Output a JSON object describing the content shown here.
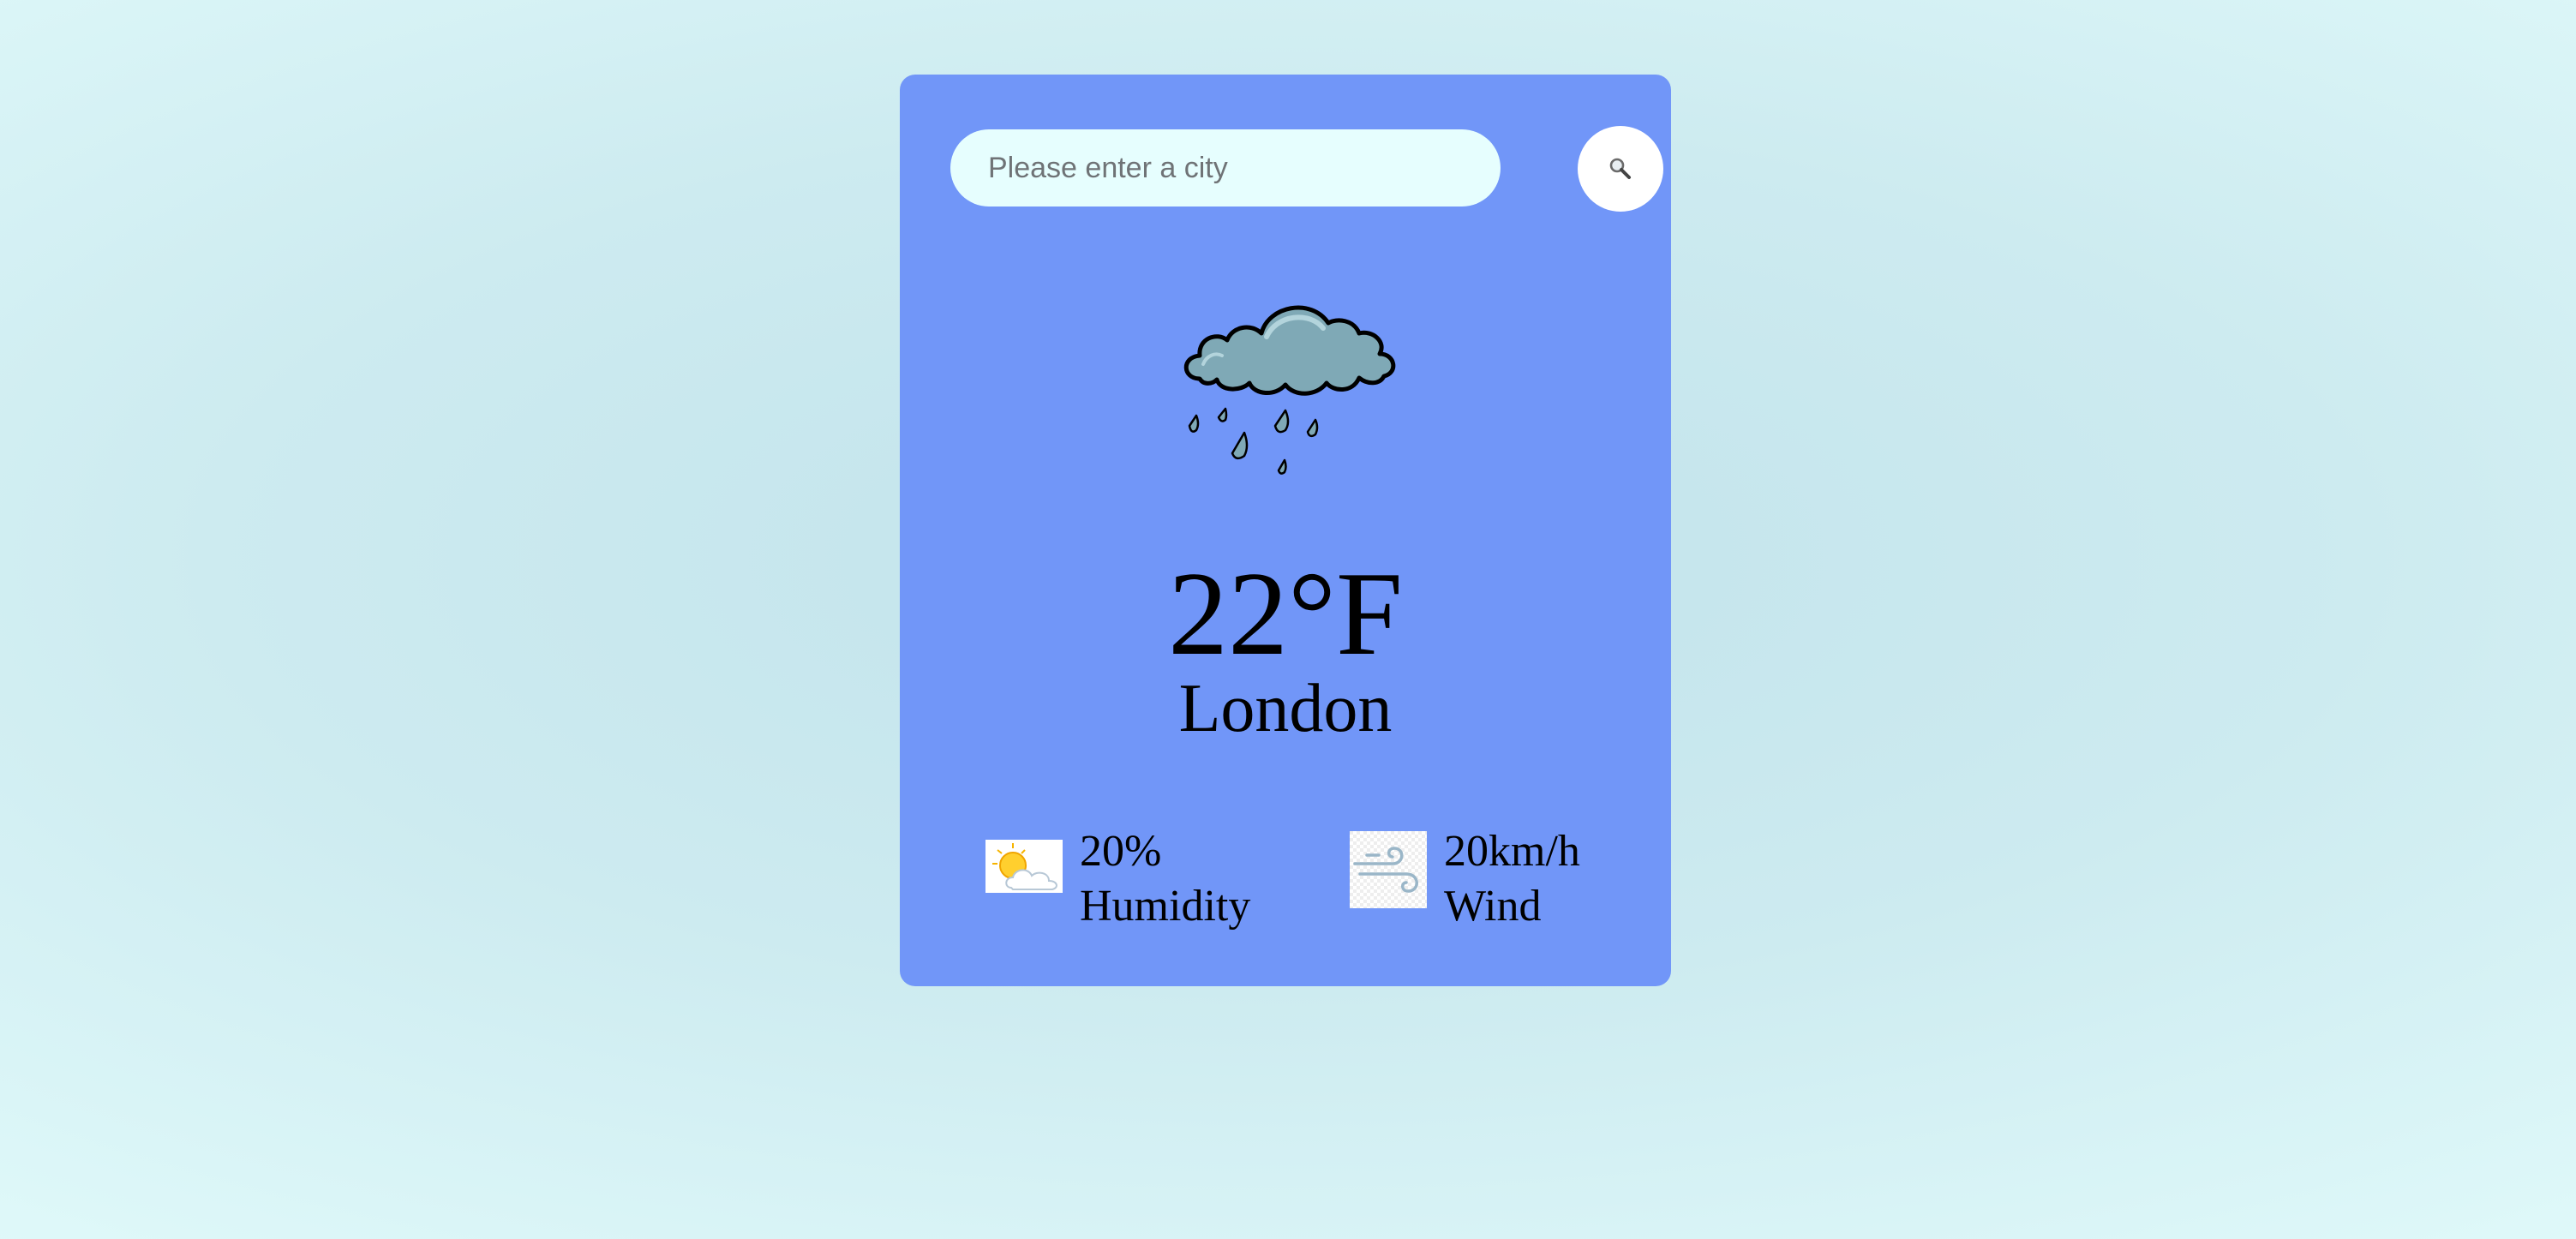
{
  "search": {
    "placeholder": "Please enter a city",
    "value": "",
    "button_icon": "search-icon"
  },
  "weather": {
    "condition_icon": "rain-cloud-icon",
    "temperature": "22°F",
    "city": "London"
  },
  "details": {
    "humidity": {
      "icon": "sun-cloud-icon",
      "value": "20%",
      "label": "Humidity"
    },
    "wind": {
      "icon": "wind-icon",
      "value": "20km/h",
      "label": "Wind"
    }
  },
  "colors": {
    "card_background": "#7196f8",
    "search_background": "#e6fefe",
    "page_background": "#c2e3eb"
  }
}
